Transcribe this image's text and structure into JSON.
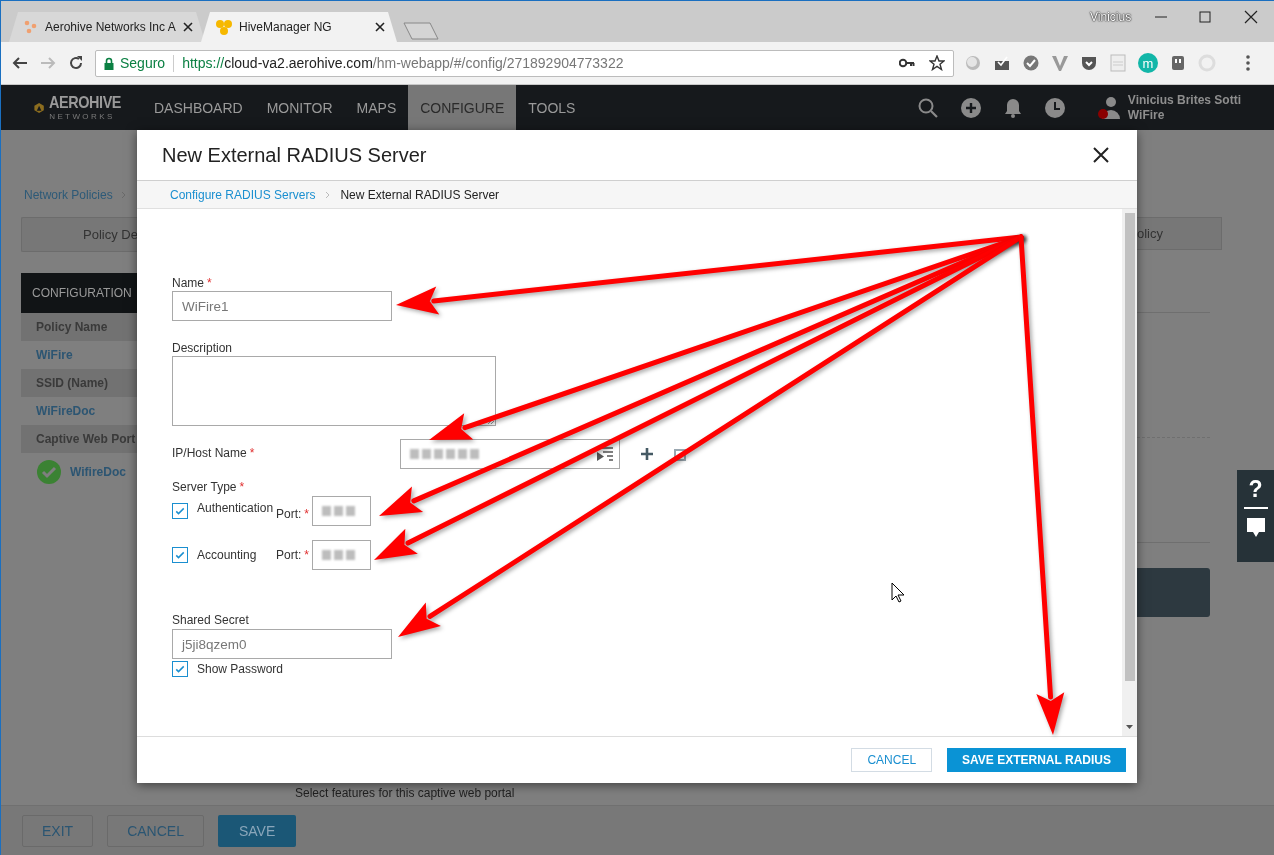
{
  "browser": {
    "tabs": [
      {
        "title": "Aerohive Networks Inc A",
        "selected": false
      },
      {
        "title": "HiveManager NG",
        "selected": true
      }
    ],
    "profile": "Vinicius",
    "security": "Seguro",
    "url": {
      "scheme": "https://",
      "host": "cloud-va2.aerohive.com",
      "path": "/hm-webapp/#/config/271892904773322"
    },
    "extension_badge": "m"
  },
  "app_nav": {
    "logo": {
      "name": "AEROHIVE",
      "sub": "NETWORKS"
    },
    "items": [
      {
        "label": "DASHBOARD",
        "selected": false
      },
      {
        "label": "MONITOR",
        "selected": false
      },
      {
        "label": "MAPS",
        "selected": false
      },
      {
        "label": "CONFIGURE",
        "selected": true
      },
      {
        "label": "TOOLS",
        "selected": false
      }
    ],
    "user": {
      "name": "Vinicius Brites Sotti",
      "org": "WiFire"
    }
  },
  "background_page": {
    "breadcrumb": "Network Policies",
    "tabs": [
      {
        "label": "Policy De"
      },
      {
        "label": "olicy"
      }
    ],
    "config_panel": {
      "title": "CONFIGURATION",
      "rows": [
        {
          "kind": "header",
          "text": "Policy Name"
        },
        {
          "kind": "value",
          "text": "WiFire"
        },
        {
          "kind": "header",
          "text": "SSID (Name)"
        },
        {
          "kind": "value",
          "text": "WiFireDoc"
        },
        {
          "kind": "header",
          "text": "Captive Web Port"
        },
        {
          "kind": "status",
          "text": "WifireDoc"
        }
      ]
    },
    "caption": "Select features for this captive web portal",
    "help_widget": {
      "label": "?"
    },
    "footer_buttons": [
      {
        "label": "EXIT",
        "kind": "secondary"
      },
      {
        "label": "CANCEL",
        "kind": "secondary"
      },
      {
        "label": "SAVE",
        "kind": "primary"
      }
    ]
  },
  "dialog": {
    "title": "New External RADIUS Server",
    "breadcrumb": [
      {
        "label": "Configure RADIUS Servers",
        "kind": "link"
      },
      {
        "label": "New External RADIUS Server",
        "kind": "current"
      }
    ],
    "name": {
      "label": "Name",
      "required_mark": "*",
      "value": "WiFire1"
    },
    "description": {
      "label": "Description"
    },
    "ip_host": {
      "label": "IP/Host Name",
      "required_mark": "*"
    },
    "server_type": {
      "label": "Server Type",
      "required_mark": "*",
      "options": [
        {
          "label": "Authentication",
          "checked": true,
          "port_label": "Port:",
          "port_required_mark": "*"
        },
        {
          "label": "Accounting",
          "checked": true,
          "port_label": "Port:",
          "port_required_mark": "*"
        }
      ]
    },
    "shared_secret": {
      "label": "Shared Secret",
      "value": "j5ji8qzem0",
      "show_password": {
        "label": "Show Password",
        "checked": true
      }
    },
    "buttons": [
      {
        "label": "CANCEL",
        "kind": "secondary"
      },
      {
        "label": "SAVE EXTERNAL RADIUS",
        "kind": "primary"
      }
    ]
  }
}
